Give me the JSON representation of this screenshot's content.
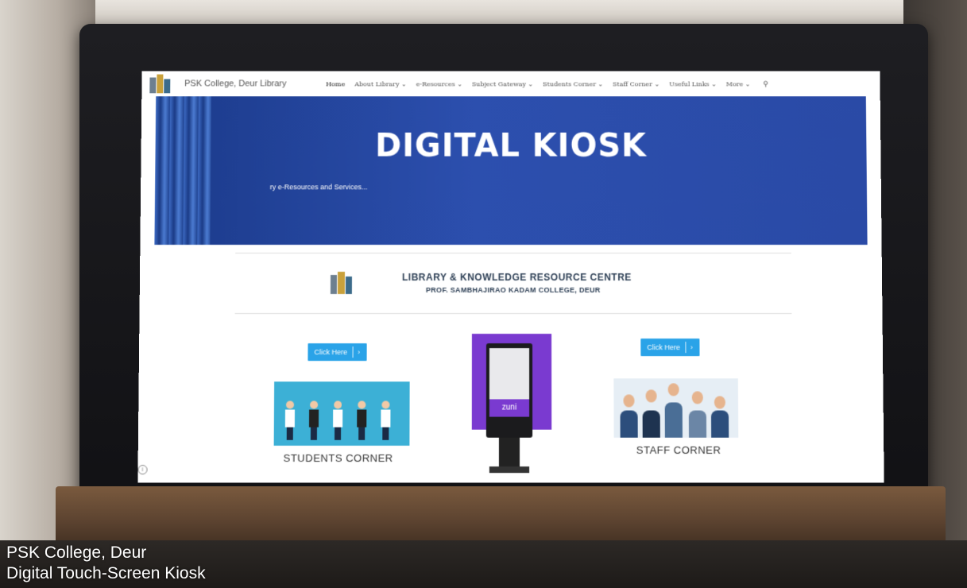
{
  "site": {
    "title": "PSK College, Deur Library"
  },
  "nav": {
    "items": [
      {
        "label": "Home",
        "active": true
      },
      {
        "label": "About Library ⌄",
        "active": false
      },
      {
        "label": "e-Resources ⌄",
        "active": false
      },
      {
        "label": "Subject Gateway ⌄",
        "active": false
      },
      {
        "label": "Students Corner ⌄",
        "active": false
      },
      {
        "label": "Staff Corner ⌄",
        "active": false
      },
      {
        "label": "Useful Links ⌄",
        "active": false
      },
      {
        "label": "More ⌄",
        "active": false
      }
    ],
    "search_icon": "search-icon"
  },
  "banner": {
    "title": "DIGITAL KIOSK",
    "subtitle": "ry e-Resources and Services..."
  },
  "resource_centre": {
    "title": "LIBRARY & KNOWLEDGE RESOURCE CENTRE",
    "subtitle": "PROF. SAMBHAJIRAO KADAM COLLEGE, DEUR"
  },
  "students": {
    "button_label": "Click Here",
    "button_chevron": "›",
    "caption": "STUDENTS CORNER"
  },
  "staff": {
    "button_label": "Click Here",
    "button_chevron": "›",
    "caption": "STAFF CORNER"
  },
  "kiosk": {
    "brand": "zuni"
  },
  "overlay": {
    "line1": "PSK College, Deur",
    "line2": "Digital Touch-Screen Kiosk"
  },
  "colors": {
    "banner": "#2a4aa6",
    "button": "#2aa3e8",
    "kiosk_purple": "#7a3ad0",
    "students_bg": "#3cb0d6"
  }
}
